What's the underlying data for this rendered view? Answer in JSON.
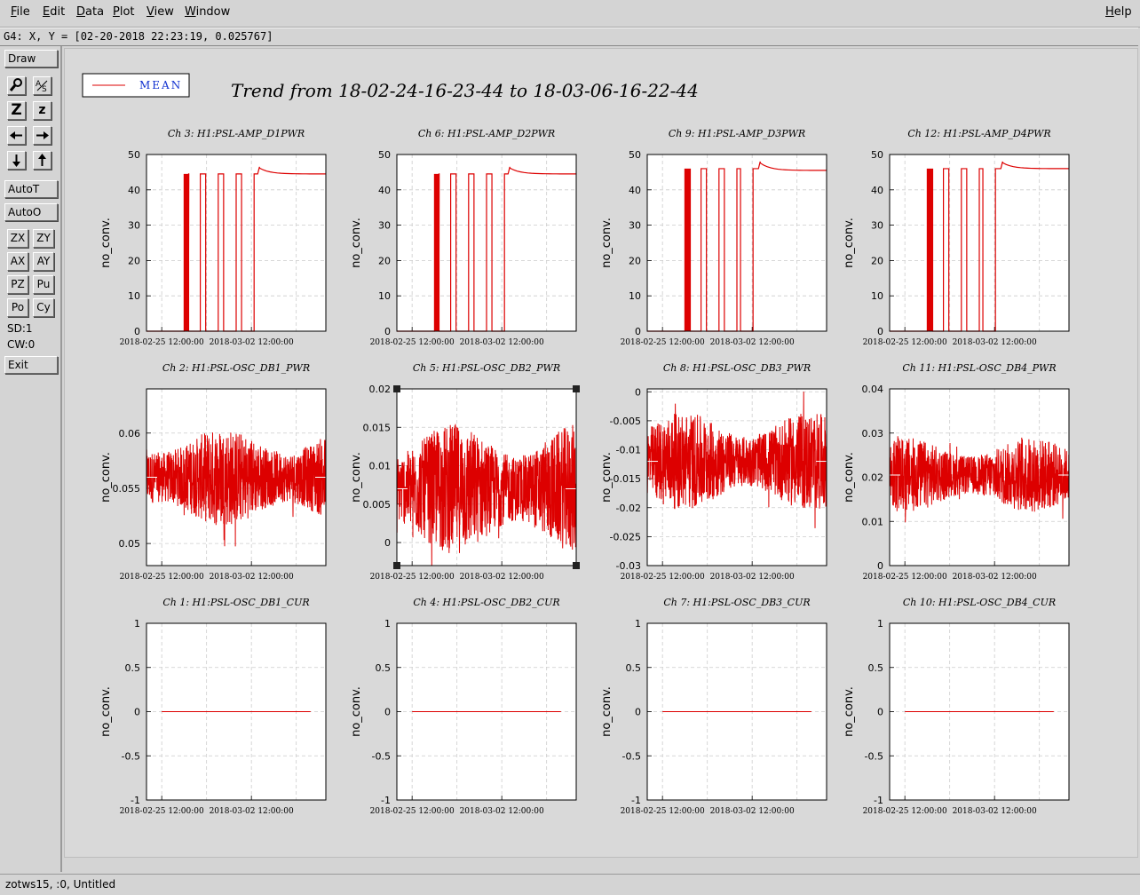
{
  "menubar": {
    "items": [
      {
        "label": "File",
        "u": "F",
        "rest": "ile"
      },
      {
        "label": "Edit",
        "u": "E",
        "rest": "dit"
      },
      {
        "label": "Data",
        "u": "D",
        "rest": "ata"
      },
      {
        "label": "Plot",
        "u": "P",
        "rest": "lot"
      },
      {
        "label": "View",
        "u": "V",
        "rest": "iew"
      },
      {
        "label": "Window",
        "u": "W",
        "rest": "indow"
      }
    ],
    "help": {
      "u": "H",
      "rest": "elp"
    }
  },
  "coord_readout": "G4: X, Y = [02-20-2018 22:23:19, 0.025767]",
  "toolbar": {
    "draw": "Draw",
    "icons": [
      "magnify-icon",
      "text-scale-icon",
      "zoom-z-big-icon",
      "zoom-z-small-icon",
      "arrow-left-icon",
      "arrow-right-icon",
      "arrow-down-icon",
      "arrow-up-icon"
    ],
    "zoom_big": "Z",
    "zoom_small": "z",
    "autot": "AutoT",
    "autoo": "AutoO",
    "pairs": [
      [
        "ZX",
        "ZY"
      ],
      [
        "AX",
        "AY"
      ],
      [
        "PZ",
        "Pu"
      ],
      [
        "Po",
        "Cy"
      ]
    ],
    "sd": "SD:1",
    "cw": "CW:0",
    "exit": "Exit"
  },
  "status_text": "zotws15, :0, Untitled",
  "legend": {
    "label": "MEAN",
    "color": "#dd0000"
  },
  "main_title": "Trend from 18-02-24-16-23-44 to 18-03-06-16-22-44",
  "x_ticks": [
    "2018-02-25 12:00:00",
    "2018-03-02 12:00:00"
  ],
  "chart_data": [
    {
      "type": "line",
      "title": "Ch 3: H1:PSL-AMP_D1PWR",
      "ylabel": "no_conv.",
      "ylim": [
        0,
        50
      ],
      "yticks": [
        "0",
        "10",
        "20",
        "30",
        "40",
        "50"
      ],
      "series": [
        {
          "kind": "dropouts",
          "level": 44.5,
          "settle": 44.5,
          "dropouts": [
            [
              0.21,
              0.235
            ],
            [
              0.3,
              0.33
            ],
            [
              0.4,
              0.43
            ],
            [
              0.5,
              0.53
            ],
            [
              0.6,
              0.62
            ]
          ]
        }
      ]
    },
    {
      "type": "line",
      "title": "Ch 6: H1:PSL-AMP_D2PWR",
      "ylabel": "no_conv.",
      "ylim": [
        0,
        50
      ],
      "yticks": [
        "0",
        "10",
        "20",
        "30",
        "40",
        "50"
      ],
      "series": [
        {
          "kind": "dropouts",
          "level": 44.5,
          "settle": 44.5,
          "dropouts": [
            [
              0.21,
              0.235
            ],
            [
              0.3,
              0.33
            ],
            [
              0.4,
              0.43
            ],
            [
              0.5,
              0.53
            ],
            [
              0.6,
              0.62
            ]
          ]
        }
      ]
    },
    {
      "type": "line",
      "title": "Ch 9: H1:PSL-AMP_D3PWR",
      "ylabel": "no_conv.",
      "ylim": [
        0,
        50
      ],
      "yticks": [
        "0",
        "10",
        "20",
        "30",
        "40",
        "50"
      ],
      "series": [
        {
          "kind": "dropouts",
          "level": 46,
          "settle": 45.5,
          "dropouts": [
            [
              0.21,
              0.24
            ],
            [
              0.3,
              0.33
            ],
            [
              0.4,
              0.43
            ],
            [
              0.5,
              0.52
            ],
            [
              0.59,
              0.62
            ]
          ]
        }
      ]
    },
    {
      "type": "line",
      "title": "Ch 12: H1:PSL-AMP_D4PWR",
      "ylabel": "no_conv.",
      "ylim": [
        0,
        50
      ],
      "yticks": [
        "0",
        "10",
        "20",
        "30",
        "40",
        "50"
      ],
      "series": [
        {
          "kind": "dropouts",
          "level": 46,
          "settle": 46,
          "dropouts": [
            [
              0.21,
              0.24
            ],
            [
              0.3,
              0.33
            ],
            [
              0.4,
              0.43
            ],
            [
              0.5,
              0.52
            ],
            [
              0.59,
              0.62
            ]
          ]
        }
      ]
    },
    {
      "type": "line",
      "title": "Ch 2: H1:PSL-OSC_DB1_PWR",
      "ylabel": "no_conv.",
      "ylim": [
        0.048,
        0.064
      ],
      "yticks": [
        "0.05",
        "0.055",
        "0.06"
      ],
      "ytickvals": [
        0.05,
        0.055,
        0.06
      ],
      "series": [
        {
          "kind": "noise",
          "mean": 0.056,
          "amp": 0.0045
        }
      ]
    },
    {
      "type": "line",
      "title": "Ch 5: H1:PSL-OSC_DB2_PWR",
      "ylabel": "no_conv.",
      "ylim": [
        -0.003,
        0.02
      ],
      "yticks": [
        "0",
        "0.005",
        "0.01",
        "0.015",
        "0.02"
      ],
      "ytickvals": [
        0,
        0.005,
        0.01,
        0.015,
        0.02
      ],
      "series": [
        {
          "kind": "noise",
          "mean": 0.007,
          "amp": 0.0085
        }
      ]
    },
    {
      "type": "line",
      "title": "Ch 8: H1:PSL-OSC_DB3_PWR",
      "ylabel": "no_conv.",
      "ylim": [
        -0.03,
        0.0005
      ],
      "yticks": [
        "-0.03",
        "-0.025",
        "-0.02",
        "-0.015",
        "-0.01",
        "-0.005",
        "0"
      ],
      "ytickvals": [
        -0.03,
        -0.025,
        -0.02,
        -0.015,
        -0.01,
        -0.005,
        0
      ],
      "series": [
        {
          "kind": "noise",
          "mean": -0.012,
          "amp": 0.0085
        }
      ]
    },
    {
      "type": "line",
      "title": "Ch 11: H1:PSL-OSC_DB4_PWR",
      "ylabel": "no_conv.",
      "ylim": [
        0,
        0.04
      ],
      "yticks": [
        "0",
        "0.01",
        "0.02",
        "0.03",
        "0.04"
      ],
      "ytickvals": [
        0,
        0.01,
        0.02,
        0.03,
        0.04
      ],
      "series": [
        {
          "kind": "noise",
          "mean": 0.0205,
          "amp": 0.0085
        }
      ]
    },
    {
      "type": "line",
      "title": "Ch 1: H1:PSL-OSC_DB1_CUR",
      "ylabel": "no_conv.",
      "ylim": [
        -1,
        1
      ],
      "yticks": [
        "-1",
        "-0.5",
        "0",
        "0.5",
        "1"
      ],
      "ytickvals": [
        -1,
        -0.5,
        0,
        0.5,
        1
      ],
      "series": [
        {
          "kind": "flat",
          "value": 0
        }
      ]
    },
    {
      "type": "line",
      "title": "Ch 4: H1:PSL-OSC_DB2_CUR",
      "ylabel": "no_conv.",
      "ylim": [
        -1,
        1
      ],
      "yticks": [
        "-1",
        "-0.5",
        "0",
        "0.5",
        "1"
      ],
      "ytickvals": [
        -1,
        -0.5,
        0,
        0.5,
        1
      ],
      "series": [
        {
          "kind": "flat",
          "value": 0
        }
      ]
    },
    {
      "type": "line",
      "title": "Ch 7: H1:PSL-OSC_DB3_CUR",
      "ylabel": "no_conv.",
      "ylim": [
        -1,
        1
      ],
      "yticks": [
        "-1",
        "-0.5",
        "0",
        "0.5",
        "1"
      ],
      "ytickvals": [
        -1,
        -0.5,
        0,
        0.5,
        1
      ],
      "series": [
        {
          "kind": "flat",
          "value": 0
        }
      ]
    },
    {
      "type": "line",
      "title": "Ch 10: H1:PSL-OSC_DB4_CUR",
      "ylabel": "no_conv.",
      "ylim": [
        -1,
        1
      ],
      "yticks": [
        "-1",
        "-0.5",
        "0",
        "0.5",
        "1"
      ],
      "ytickvals": [
        -1,
        -0.5,
        0,
        0.5,
        1
      ],
      "series": [
        {
          "kind": "flat",
          "value": 0
        }
      ]
    }
  ]
}
